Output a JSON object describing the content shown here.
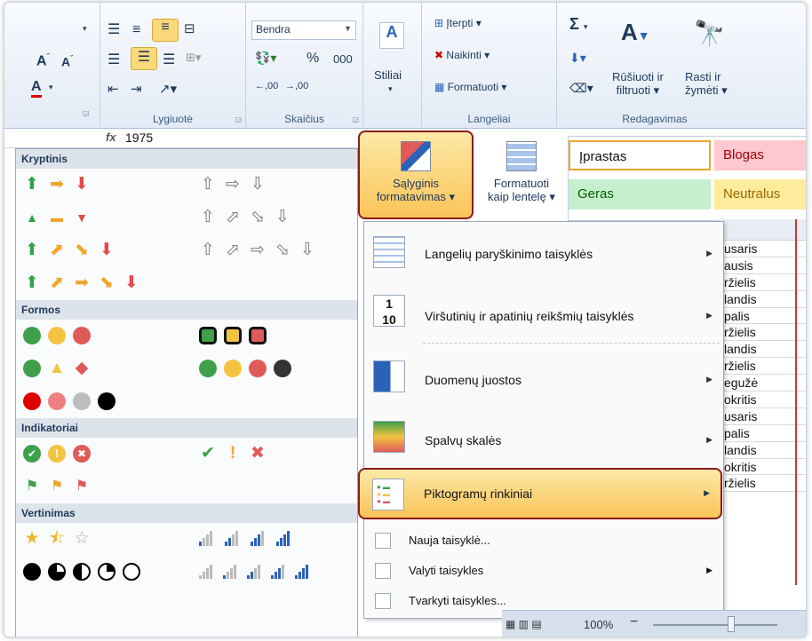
{
  "ribbon": {
    "font_combo": "Bendra",
    "percent": "%",
    "thousands": "000",
    "dec_inc": ",00",
    "dec_dec": ",00",
    "styles_label": "Stiliai",
    "insert": "Įterpti",
    "delete": "Naikinti",
    "format": "Formatuoti",
    "sort_filter_1": "Rūšiuoti ir",
    "sort_filter_2": "filtruoti",
    "find_select_1": "Rasti ir",
    "find_select_2": "žymėti",
    "sigma": "Σ",
    "groups": {
      "alignment": "Lygiuotė",
      "number": "Skaičius",
      "cells": "Langeliai",
      "editing": "Redagavimas"
    }
  },
  "formula": {
    "fx": "fx",
    "value": "1975"
  },
  "buttons": {
    "cond_format_1": "Sąlyginis",
    "cond_format_2": "formatavimas",
    "format_table_1": "Formatuoti",
    "format_table_2": "kaip lentelę"
  },
  "cell_styles": {
    "normal": "Įprastas",
    "bad": "Blogas",
    "good": "Geras",
    "neutral": "Neutralus"
  },
  "icon_sets": {
    "directional": "Kryptinis",
    "shapes": "Formos",
    "indicators": "Indikatoriai",
    "ratings": "Vertinimas"
  },
  "menu": {
    "highlight_rules": "Langelių paryškinimo taisyklės",
    "top_bottom_rules": "Viršutinių ir apatinių reikšmių taisyklės",
    "data_bars": "Duomenų juostos",
    "color_scales": "Spalvų skalės",
    "icon_sets": "Piktogramų rinkiniai",
    "new_rule": "Nauja taisyklė...",
    "clear_rules": "Valyti taisykles",
    "manage_rules": "Tvarkyti taisykles..."
  },
  "sheet": {
    "rows": [
      "usaris",
      "ausis",
      "ržielis",
      "landis",
      "palis",
      "ržielis",
      "landis",
      "ržielis",
      "egužė",
      "okritis",
      "usaris",
      "palis",
      "landis",
      "okritis",
      "ržielis"
    ]
  },
  "status": {
    "zoom": "100%",
    "minus": "−"
  },
  "colors": {
    "bad_bg": "#ffc7ce",
    "bad_fg": "#9c0006",
    "good_bg": "#c6efce",
    "good_fg": "#006100",
    "neutral_bg": "#ffeb9c",
    "neutral_fg": "#9c6500",
    "highlight": "#8a1b1b"
  }
}
